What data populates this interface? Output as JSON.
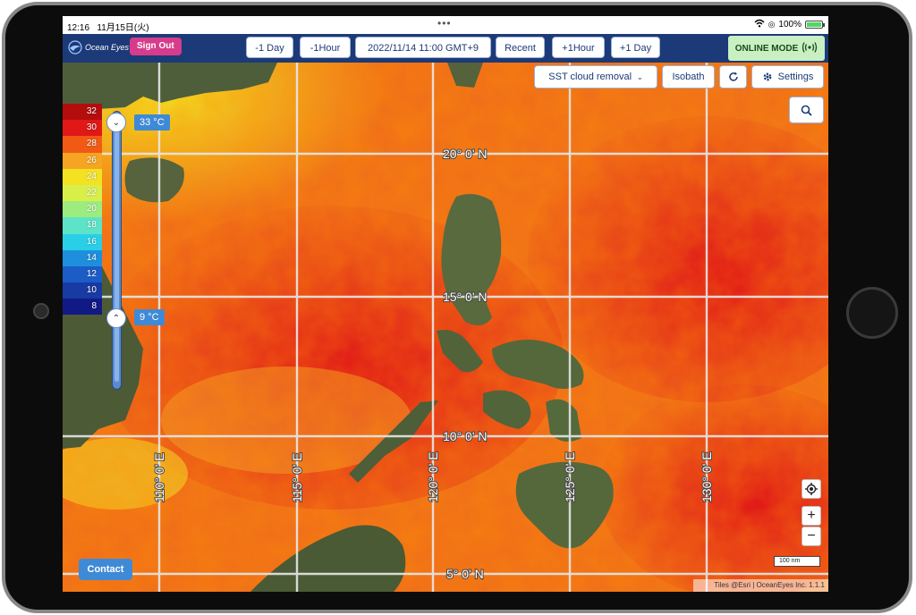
{
  "statusbar": {
    "time": "12:16",
    "date": "11月15日(火)",
    "battery": "100%",
    "multitask_dots": "•••"
  },
  "appbar": {
    "logo_text": "Ocean Eyes",
    "sign_out": "Sign Out",
    "buttons": [
      "-1 Day",
      "-1Hour",
      "2022/11/14 11:00 GMT+9",
      "Recent",
      "+1Hour",
      "+1 Day"
    ],
    "online_mode": "ONLINE MODE"
  },
  "controls": {
    "layer_select": "SST cloud removal",
    "isobath": "Isobath",
    "settings": "Settings"
  },
  "legend": {
    "values": [
      "32",
      "30",
      "28",
      "26",
      "24",
      "22",
      "20",
      "18",
      "16",
      "14",
      "12",
      "10",
      "8"
    ],
    "colors": [
      "#b40d0d",
      "#e01818",
      "#f05a14",
      "#f5a521",
      "#f2e222",
      "#d8ef4a",
      "#9cec80",
      "#5de3c7",
      "#28cfe6",
      "#1e8fdd",
      "#1b5cc6",
      "#183aa3",
      "#111a84"
    ],
    "max_temp": "33 °C",
    "min_temp": "9 °C"
  },
  "grid": {
    "lat_labels": [
      "20° 0' N",
      "15° 0' N",
      "10° 0' N",
      "5° 0' N"
    ],
    "lon_labels": [
      "110° 0' E",
      "115° 0' E",
      "120° 0' E",
      "125° 0' E",
      "130° 0' E"
    ]
  },
  "map": {
    "scale": "100 nm",
    "attribution": "Tiles @Esri | OceanEyes Inc. 1.1.1",
    "contact": "Contact",
    "zoom_in": "+",
    "zoom_out": "−"
  }
}
